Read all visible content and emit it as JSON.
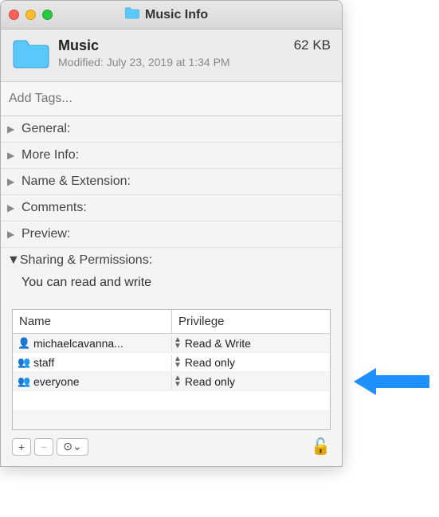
{
  "titlebar": {
    "title": "Music Info"
  },
  "file": {
    "name": "Music",
    "size": "62 KB",
    "modified_label": "Modified:",
    "modified_value": "July 23, 2019 at 1:34 PM"
  },
  "tags": {
    "placeholder": "Add Tags..."
  },
  "sections": {
    "general": "General:",
    "more_info": "More Info:",
    "name_ext": "Name & Extension:",
    "comments": "Comments:",
    "preview": "Preview:",
    "sharing": "Sharing & Permissions:"
  },
  "sharing": {
    "message": "You can read and write",
    "columns": {
      "name": "Name",
      "privilege": "Privilege"
    },
    "rows": [
      {
        "icon": "person-icon",
        "name": "michaelcavanna...",
        "privilege": "Read & Write"
      },
      {
        "icon": "group-icon",
        "name": "staff",
        "privilege": "Read only"
      },
      {
        "icon": "people-icon",
        "name": "everyone",
        "privilege": "Read only"
      }
    ]
  },
  "buttons": {
    "add": "+",
    "remove": "−",
    "action": "⊙",
    "action_chev": "⌄"
  }
}
